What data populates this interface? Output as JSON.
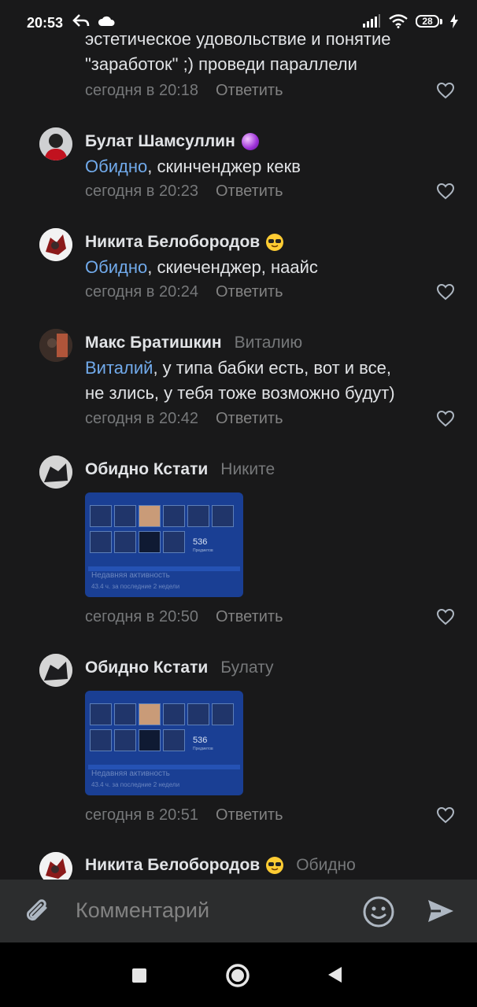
{
  "status_bar": {
    "time": "20:53",
    "battery": "28"
  },
  "comments": [
    {
      "id": "partial",
      "text_line1": "эстетическое удовольствие  и понятие",
      "text_line2": "\"заработок\" ;) проведи параллели",
      "time": "сегодня в 20:18",
      "reply": "Ответить"
    },
    {
      "id": "bulat",
      "author": "Булат Шамсуллин",
      "emoji": "crystal-ball-emoji",
      "mention": "Обидно",
      "text": ", скинченджер кекв",
      "time": "сегодня в 20:23",
      "reply": "Ответить"
    },
    {
      "id": "nikita1",
      "author": "Никита Белобородов",
      "emoji": "sunglasses-emoji",
      "mention": "Обидно",
      "text": ", скиеченджер, наайс",
      "time": "сегодня в 20:24",
      "reply": "Ответить"
    },
    {
      "id": "maks",
      "author": "Макс Братишкин",
      "reply_to": "Виталию",
      "mention": "Виталий",
      "text_line1": ", у типа бабки есть, вот и все,",
      "text_line2": "не злись, у тебя тоже возможно будут)",
      "time": "сегодня в 20:42",
      "reply": "Ответить"
    },
    {
      "id": "obidno1",
      "author": "Обидно Кстати",
      "reply_to": "Никите",
      "image": {
        "count": "536",
        "count_label": "Предметов",
        "activity": "Недавняя активность",
        "hours": "43.4 ч. за последние 2 недели"
      },
      "time": "сегодня в 20:50",
      "reply": "Ответить"
    },
    {
      "id": "obidno2",
      "author": "Обидно Кстати",
      "reply_to": "Булату",
      "image": {
        "count": "536",
        "count_label": "Предметов",
        "activity": "Недавняя активность",
        "hours": "43.4 ч. за последние 2 недели"
      },
      "time": "сегодня в 20:51",
      "reply": "Ответить"
    },
    {
      "id": "nikita2",
      "author": "Никита Белобородов",
      "emoji": "sunglasses-emoji",
      "reply_to": "Обидно"
    }
  ],
  "composer": {
    "placeholder": "Комментарий"
  },
  "colors": {
    "background": "#19191a",
    "link": "#71aaeb",
    "secondary": "#76787a",
    "composer": "#2c2d2e"
  }
}
